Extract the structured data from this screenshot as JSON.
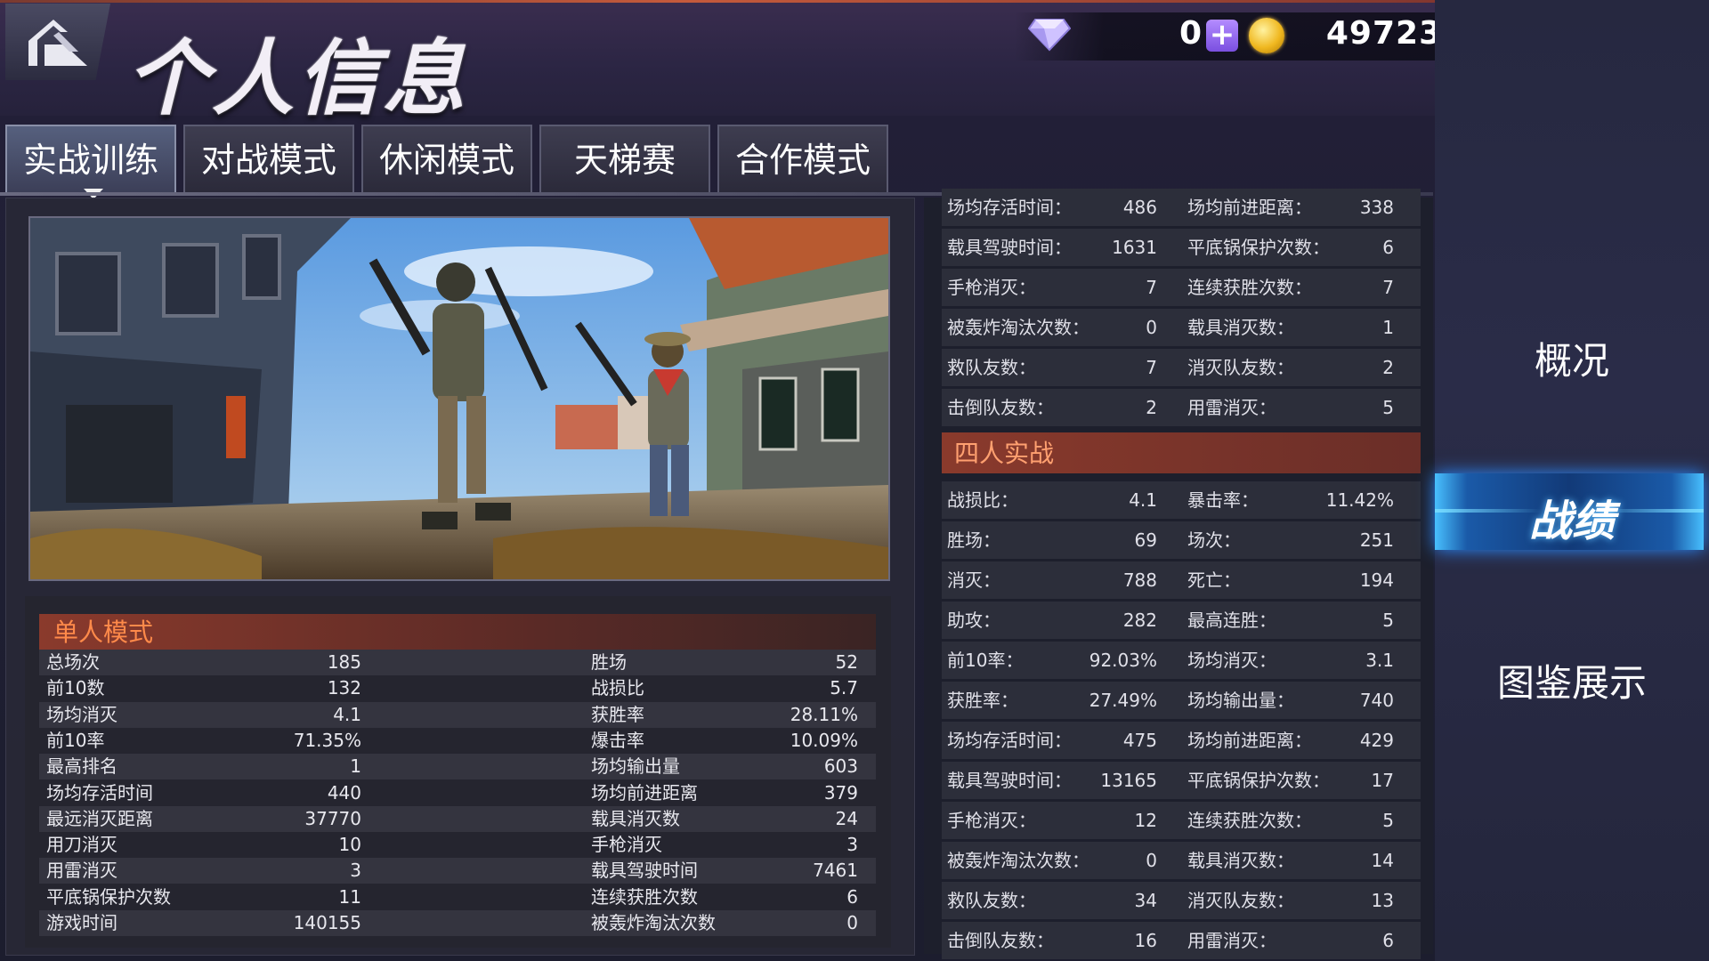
{
  "header": {
    "title": "个人信息"
  },
  "currency": {
    "gems": "0",
    "coins": "49723"
  },
  "tabs": [
    {
      "label": "实战训练",
      "active": true
    },
    {
      "label": "对战模式",
      "active": false
    },
    {
      "label": "休闲模式",
      "active": false
    },
    {
      "label": "天梯赛",
      "active": false
    },
    {
      "label": "合作模式",
      "active": false
    }
  ],
  "single_mode": {
    "title": "单人模式",
    "rows": [
      [
        "总场次",
        "185",
        "胜场",
        "52"
      ],
      [
        "前10数",
        "132",
        "战损比",
        "5.7"
      ],
      [
        "场均消灭",
        "4.1",
        "获胜率",
        "28.11%"
      ],
      [
        "前10率",
        "71.35%",
        "爆击率",
        "10.09%"
      ],
      [
        "最高排名",
        "1",
        "场均输出量",
        "603"
      ],
      [
        "场均存活时间",
        "440",
        "场均前进距离",
        "379"
      ],
      [
        "最远消灭距离",
        "37770",
        "载具消灭数",
        "24"
      ],
      [
        "用刀消灭",
        "10",
        "手枪消灭",
        "3"
      ],
      [
        "用雷消灭",
        "3",
        "载具驾驶时间",
        "7461"
      ],
      [
        "平底锅保护次数",
        "11",
        "连续获胜次数",
        "6"
      ],
      [
        "游戏时间",
        "140155",
        "被轰炸淘汰次数",
        "0"
      ]
    ]
  },
  "stats_top": [
    [
      "场均存活时间：",
      "486",
      "场均前进距离：",
      "338"
    ],
    [
      "载具驾驶时间：",
      "1631",
      "平底锅保护次数：",
      "6"
    ],
    [
      "手枪消灭：",
      "7",
      "连续获胜次数：",
      "7"
    ],
    [
      "被轰炸淘汰次数：",
      "0",
      "载具消灭数：",
      "1"
    ],
    [
      "救队友数：",
      "7",
      "消灭队友数：",
      "2"
    ],
    [
      "击倒队友数：",
      "2",
      "用雷消灭：",
      "5"
    ]
  ],
  "squad": {
    "title": "四人实战",
    "rows": [
      [
        "战损比：",
        "4.1",
        "暴击率：",
        "11.42%"
      ],
      [
        "胜场：",
        "69",
        "场次：",
        "251"
      ],
      [
        "消灭：",
        "788",
        "死亡：",
        "194"
      ],
      [
        "助攻：",
        "282",
        "最高连胜：",
        "5"
      ],
      [
        "前10率：",
        "92.03%",
        "场均消灭：",
        "3.1"
      ],
      [
        "获胜率：",
        "27.49%",
        "场均输出量：",
        "740"
      ],
      [
        "场均存活时间：",
        "475",
        "场均前进距离：",
        "429"
      ],
      [
        "载具驾驶时间：",
        "13165",
        "平底锅保护次数：",
        "17"
      ],
      [
        "手枪消灭：",
        "12",
        "连续获胜次数：",
        "5"
      ],
      [
        "被轰炸淘汰次数：",
        "0",
        "载具消灭数：",
        "14"
      ],
      [
        "救队友数：",
        "34",
        "消灭队友数：",
        "13"
      ],
      [
        "击倒队友数：",
        "16",
        "用雷消灭：",
        "6"
      ]
    ]
  },
  "nav": [
    {
      "label": "概况",
      "active": false
    },
    {
      "label": "战绩",
      "active": true
    },
    {
      "label": "图鉴展示",
      "active": false
    }
  ]
}
